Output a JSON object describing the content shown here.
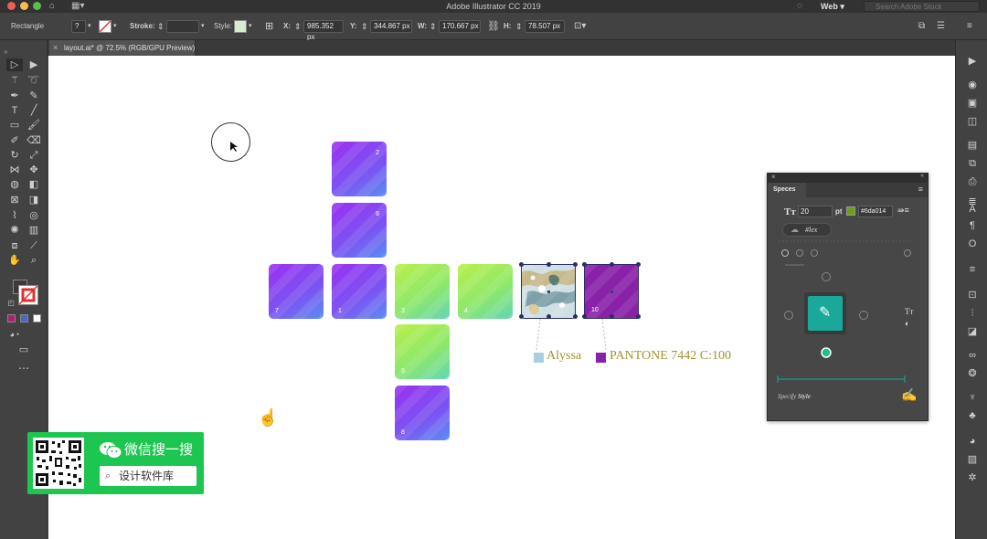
{
  "window": {
    "title": "Adobe Illustrator CC 2019",
    "workspace": "Web",
    "stock_search_placeholder": "Search Adobe Stock"
  },
  "controlbar": {
    "selection_type": "Rectangle",
    "stroke_label": "Stroke:",
    "style_label": "Style:",
    "x_label": "X:",
    "x_value": "985.352 px",
    "y_label": "Y:",
    "y_value": "344.867 px",
    "w_label": "W:",
    "w_value": "170.667 px",
    "h_label": "H:",
    "h_value": "78.507 px"
  },
  "document": {
    "tab_label": "layout.ai* @ 72.5% (RGB/GPU Preview)"
  },
  "tiles": {
    "t2": "2",
    "t6": "6",
    "t7": "7",
    "t1": "1",
    "t3": "3",
    "t4": "4",
    "t10": "10",
    "t5": "5",
    "t8": "8"
  },
  "swatches": {
    "alyssa_label": "Alyssa",
    "pantone_label": "PANTONE 7442 C:100",
    "alyssa_color": "#a9cfdf",
    "pantone_color": "#8a21a9"
  },
  "panel": {
    "tab": "Speces",
    "font_size_value": "20",
    "font_size_unit": "pt",
    "hex_value": "#6da014",
    "tag_label": "#lex",
    "specify_label": "Specify",
    "style_label": "Style",
    "accent_color": "#1aa89b"
  },
  "wechat": {
    "title": "微信搜一搜",
    "search_text": "设计软件库"
  },
  "colors": {
    "canvas_bg": "#ffffff",
    "chrome_bg": "#424242",
    "wechat_green": "#1cc650"
  }
}
